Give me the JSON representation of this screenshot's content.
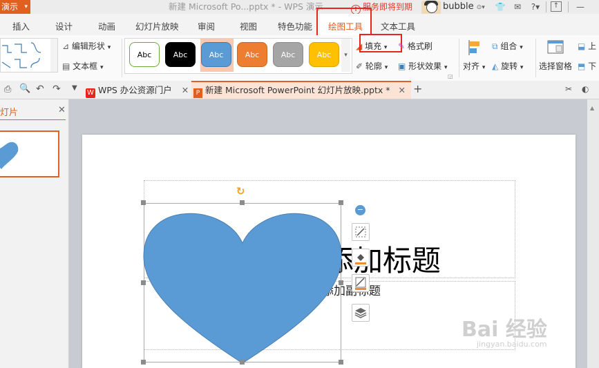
{
  "titlebar": {
    "app_label": "演示",
    "doc_title": "新建 Microsoft Po...pptx * - WPS 演示",
    "service_notice": "服务即将到期",
    "username": "bubble"
  },
  "menu_tabs": [
    "插入",
    "设计",
    "动画",
    "幻灯片放映",
    "审阅",
    "视图",
    "特色功能",
    "绘图工具",
    "文本工具"
  ],
  "ribbon": {
    "edit_shape": "编辑形状",
    "text_box": "文本框",
    "style_samples": [
      {
        "label": "Abc",
        "bg": "#ffffff",
        "border": "#6aab3a",
        "fg": "#000000"
      },
      {
        "label": "Abc",
        "bg": "#000000",
        "border": "#000000",
        "fg": "#ffffff"
      },
      {
        "label": "Abc",
        "bg": "#5b9bd5",
        "border": "#3f7cb4",
        "fg": "#ffffff"
      },
      {
        "label": "Abc",
        "bg": "#ed7d31",
        "border": "#c9651f",
        "fg": "#ffffff"
      },
      {
        "label": "Abc",
        "bg": "#a5a5a5",
        "border": "#8a8a8a",
        "fg": "#ffffff"
      },
      {
        "label": "Abc",
        "bg": "#ffc000",
        "border": "#d9a300",
        "fg": "#ffffff"
      }
    ],
    "fill": "填充",
    "format_painter": "格式刷",
    "outline": "轮廓",
    "shape_effects": "形状效果",
    "group": "组合",
    "align": "对齐",
    "rotate": "旋转",
    "select_pane": "选择窗格",
    "up": "上",
    "down": "下"
  },
  "doc_tabs": [
    {
      "label": "WPS 办公资源门户"
    },
    {
      "label": "新建 Microsoft PowerPoint 幻灯片放映.pptx *"
    }
  ],
  "left_panel": {
    "title": "灯片"
  },
  "slide": {
    "title_placeholder": "添加标题",
    "subtitle_placeholder": "添加副标题",
    "heart_color": "#5b9bd5"
  },
  "watermark": {
    "brand": "Bai  经验",
    "url": "jingyan.baidu.com"
  },
  "colors": {
    "accent": "#e2601f",
    "highlight": "#e8241c"
  }
}
